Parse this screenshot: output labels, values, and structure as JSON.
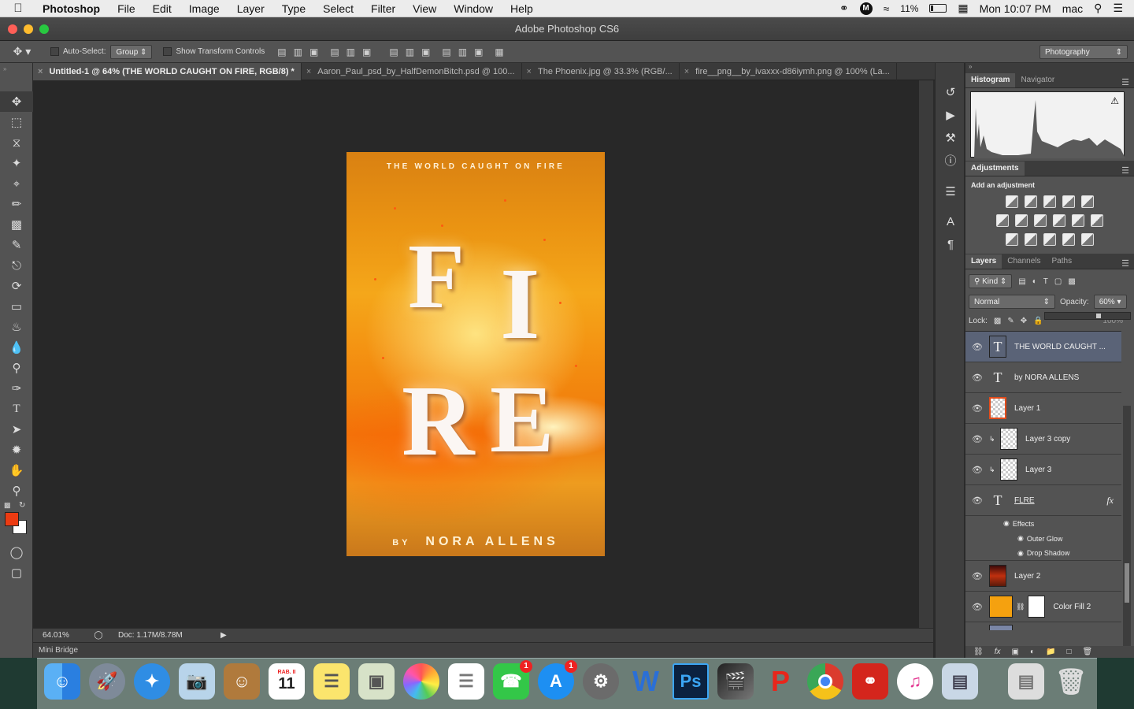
{
  "menubar": {
    "app_name": "Photoshop",
    "menus": [
      "File",
      "Edit",
      "Image",
      "Layer",
      "Type",
      "Select",
      "Filter",
      "View",
      "Window",
      "Help"
    ],
    "battery": "11%",
    "clock": "Mon 10:07 PM",
    "user": "mac"
  },
  "window": {
    "title": "Adobe Photoshop CS6"
  },
  "options": {
    "auto_select_label": "Auto-Select:",
    "auto_select_value": "Group",
    "transform_label": "Show Transform Controls",
    "workspace": "Photography"
  },
  "tabs": [
    {
      "label": "Untitled-1 @ 64% (THE WORLD CAUGHT ON FIRE, RGB/8) *",
      "active": true
    },
    {
      "label": "Aaron_Paul_psd_by_HalfDemonBitch.psd @ 100...",
      "active": false
    },
    {
      "label": "The Phoenix.jpg @ 33.3% (RGB/...",
      "active": false
    },
    {
      "label": "fire__png__by_ivaxxx-d86iymh.png @ 100% (La...",
      "active": false
    }
  ],
  "poster": {
    "headline": "THE WORLD CAUGHT ON FIRE",
    "letters": [
      "F",
      "I",
      "R",
      "E"
    ],
    "author_prefix": "BY",
    "author": "NORA ALLENS"
  },
  "status": {
    "zoom": "64.01%",
    "doc": "Doc: 1.17M/8.78M"
  },
  "mini_bridge": "Mini Bridge",
  "panels": {
    "histogram_tab": "Histogram",
    "navigator_tab": "Navigator",
    "adjustments_tab": "Adjustments",
    "add_adjustment": "Add an adjustment",
    "layers_tab": "Layers",
    "channels_tab": "Channels",
    "paths_tab": "Paths",
    "kind": "Kind",
    "blend_mode": "Normal",
    "opacity_label": "Opacity:",
    "opacity_value": "60%",
    "lock_label": "Lock:",
    "fill_value": "100%"
  },
  "layers": [
    {
      "name": "THE WORLD CAUGHT ...",
      "type": "text",
      "selected": true
    },
    {
      "name": "by NORA ALLENS",
      "type": "text",
      "selected": false
    },
    {
      "name": "Layer 1",
      "type": "image",
      "selected": false
    },
    {
      "name": "Layer 3 copy",
      "type": "clipped",
      "selected": false
    },
    {
      "name": "Layer 3",
      "type": "clipped",
      "selected": false
    },
    {
      "name": "FLRE",
      "type": "text-fx",
      "selected": false
    },
    {
      "name": "Layer 2",
      "type": "image",
      "selected": false
    },
    {
      "name": "Color Fill 2",
      "type": "fill",
      "selected": false
    }
  ],
  "effects": {
    "label": "Effects",
    "items": [
      "Outer Glow",
      "Drop Shadow"
    ]
  },
  "dock_badges": {
    "facetime": "1",
    "appstore": "1"
  },
  "calendar": {
    "month": "RAB. II",
    "day": "11"
  }
}
